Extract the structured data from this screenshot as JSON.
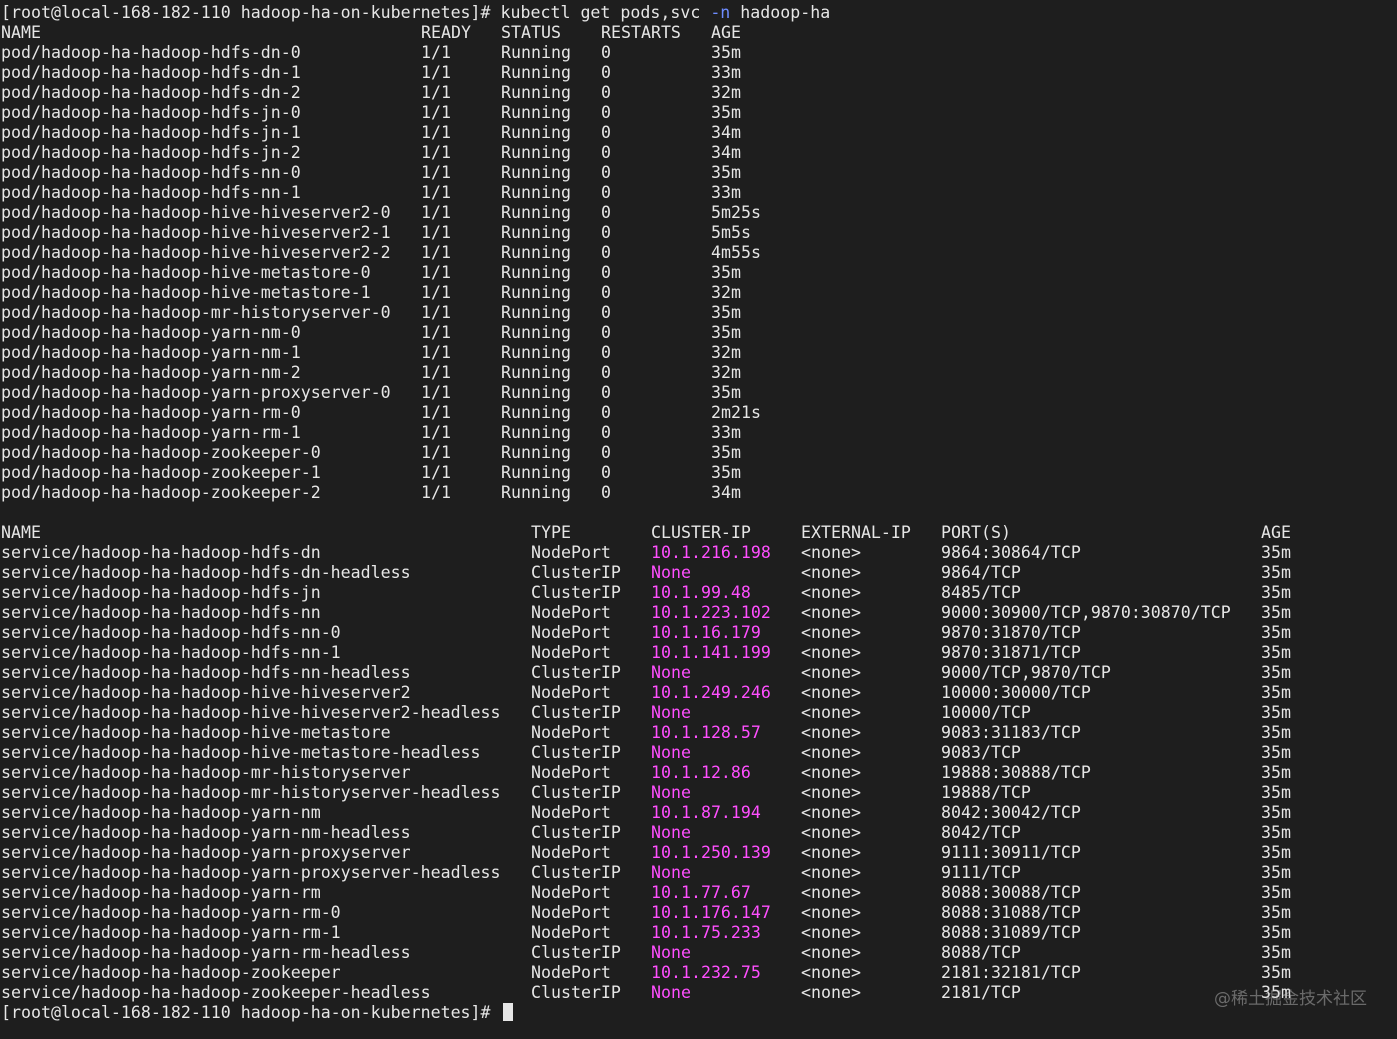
{
  "prompt": {
    "text": "[root@local-168-182-110 hadoop-ha-on-kubernetes]# ",
    "command": "kubectl get pods,svc ",
    "flag": "-n",
    "namespace": " hadoop-ha",
    "final_prompt": "[root@local-168-182-110 hadoop-ha-on-kubernetes]#"
  },
  "pods": {
    "headers": [
      "NAME",
      "READY",
      "STATUS",
      "RESTARTS",
      "AGE"
    ],
    "rows": [
      [
        "pod/hadoop-ha-hadoop-hdfs-dn-0",
        "1/1",
        "Running",
        "0",
        "35m"
      ],
      [
        "pod/hadoop-ha-hadoop-hdfs-dn-1",
        "1/1",
        "Running",
        "0",
        "33m"
      ],
      [
        "pod/hadoop-ha-hadoop-hdfs-dn-2",
        "1/1",
        "Running",
        "0",
        "32m"
      ],
      [
        "pod/hadoop-ha-hadoop-hdfs-jn-0",
        "1/1",
        "Running",
        "0",
        "35m"
      ],
      [
        "pod/hadoop-ha-hadoop-hdfs-jn-1",
        "1/1",
        "Running",
        "0",
        "34m"
      ],
      [
        "pod/hadoop-ha-hadoop-hdfs-jn-2",
        "1/1",
        "Running",
        "0",
        "34m"
      ],
      [
        "pod/hadoop-ha-hadoop-hdfs-nn-0",
        "1/1",
        "Running",
        "0",
        "35m"
      ],
      [
        "pod/hadoop-ha-hadoop-hdfs-nn-1",
        "1/1",
        "Running",
        "0",
        "33m"
      ],
      [
        "pod/hadoop-ha-hadoop-hive-hiveserver2-0",
        "1/1",
        "Running",
        "0",
        "5m25s"
      ],
      [
        "pod/hadoop-ha-hadoop-hive-hiveserver2-1",
        "1/1",
        "Running",
        "0",
        "5m5s"
      ],
      [
        "pod/hadoop-ha-hadoop-hive-hiveserver2-2",
        "1/1",
        "Running",
        "0",
        "4m55s"
      ],
      [
        "pod/hadoop-ha-hadoop-hive-metastore-0",
        "1/1",
        "Running",
        "0",
        "35m"
      ],
      [
        "pod/hadoop-ha-hadoop-hive-metastore-1",
        "1/1",
        "Running",
        "0",
        "32m"
      ],
      [
        "pod/hadoop-ha-hadoop-mr-historyserver-0",
        "1/1",
        "Running",
        "0",
        "35m"
      ],
      [
        "pod/hadoop-ha-hadoop-yarn-nm-0",
        "1/1",
        "Running",
        "0",
        "35m"
      ],
      [
        "pod/hadoop-ha-hadoop-yarn-nm-1",
        "1/1",
        "Running",
        "0",
        "32m"
      ],
      [
        "pod/hadoop-ha-hadoop-yarn-nm-2",
        "1/1",
        "Running",
        "0",
        "32m"
      ],
      [
        "pod/hadoop-ha-hadoop-yarn-proxyserver-0",
        "1/1",
        "Running",
        "0",
        "35m"
      ],
      [
        "pod/hadoop-ha-hadoop-yarn-rm-0",
        "1/1",
        "Running",
        "0",
        "2m21s"
      ],
      [
        "pod/hadoop-ha-hadoop-yarn-rm-1",
        "1/1",
        "Running",
        "0",
        "33m"
      ],
      [
        "pod/hadoop-ha-hadoop-zookeeper-0",
        "1/1",
        "Running",
        "0",
        "35m"
      ],
      [
        "pod/hadoop-ha-hadoop-zookeeper-1",
        "1/1",
        "Running",
        "0",
        "35m"
      ],
      [
        "pod/hadoop-ha-hadoop-zookeeper-2",
        "1/1",
        "Running",
        "0",
        "34m"
      ]
    ]
  },
  "services": {
    "headers": [
      "NAME",
      "TYPE",
      "CLUSTER-IP",
      "EXTERNAL-IP",
      "PORT(S)",
      "AGE"
    ],
    "rows": [
      [
        "service/hadoop-ha-hadoop-hdfs-dn",
        "NodePort",
        "10.1.216.198",
        "<none>",
        "9864:30864/TCP",
        "35m"
      ],
      [
        "service/hadoop-ha-hadoop-hdfs-dn-headless",
        "ClusterIP",
        "None",
        "<none>",
        "9864/TCP",
        "35m"
      ],
      [
        "service/hadoop-ha-hadoop-hdfs-jn",
        "ClusterIP",
        "10.1.99.48",
        "<none>",
        "8485/TCP",
        "35m"
      ],
      [
        "service/hadoop-ha-hadoop-hdfs-nn",
        "NodePort",
        "10.1.223.102",
        "<none>",
        "9000:30900/TCP,9870:30870/TCP",
        "35m"
      ],
      [
        "service/hadoop-ha-hadoop-hdfs-nn-0",
        "NodePort",
        "10.1.16.179",
        "<none>",
        "9870:31870/TCP",
        "35m"
      ],
      [
        "service/hadoop-ha-hadoop-hdfs-nn-1",
        "NodePort",
        "10.1.141.199",
        "<none>",
        "9870:31871/TCP",
        "35m"
      ],
      [
        "service/hadoop-ha-hadoop-hdfs-nn-headless",
        "ClusterIP",
        "None",
        "<none>",
        "9000/TCP,9870/TCP",
        "35m"
      ],
      [
        "service/hadoop-ha-hadoop-hive-hiveserver2",
        "NodePort",
        "10.1.249.246",
        "<none>",
        "10000:30000/TCP",
        "35m"
      ],
      [
        "service/hadoop-ha-hadoop-hive-hiveserver2-headless",
        "ClusterIP",
        "None",
        "<none>",
        "10000/TCP",
        "35m"
      ],
      [
        "service/hadoop-ha-hadoop-hive-metastore",
        "NodePort",
        "10.1.128.57",
        "<none>",
        "9083:31183/TCP",
        "35m"
      ],
      [
        "service/hadoop-ha-hadoop-hive-metastore-headless",
        "ClusterIP",
        "None",
        "<none>",
        "9083/TCP",
        "35m"
      ],
      [
        "service/hadoop-ha-hadoop-mr-historyserver",
        "NodePort",
        "10.1.12.86",
        "<none>",
        "19888:30888/TCP",
        "35m"
      ],
      [
        "service/hadoop-ha-hadoop-mr-historyserver-headless",
        "ClusterIP",
        "None",
        "<none>",
        "19888/TCP",
        "35m"
      ],
      [
        "service/hadoop-ha-hadoop-yarn-nm",
        "NodePort",
        "10.1.87.194",
        "<none>",
        "8042:30042/TCP",
        "35m"
      ],
      [
        "service/hadoop-ha-hadoop-yarn-nm-headless",
        "ClusterIP",
        "None",
        "<none>",
        "8042/TCP",
        "35m"
      ],
      [
        "service/hadoop-ha-hadoop-yarn-proxyserver",
        "NodePort",
        "10.1.250.139",
        "<none>",
        "9111:30911/TCP",
        "35m"
      ],
      [
        "service/hadoop-ha-hadoop-yarn-proxyserver-headless",
        "ClusterIP",
        "None",
        "<none>",
        "9111/TCP",
        "35m"
      ],
      [
        "service/hadoop-ha-hadoop-yarn-rm",
        "NodePort",
        "10.1.77.67",
        "<none>",
        "8088:30088/TCP",
        "35m"
      ],
      [
        "service/hadoop-ha-hadoop-yarn-rm-0",
        "NodePort",
        "10.1.176.147",
        "<none>",
        "8088:31088/TCP",
        "35m"
      ],
      [
        "service/hadoop-ha-hadoop-yarn-rm-1",
        "NodePort",
        "10.1.75.233",
        "<none>",
        "8088:31089/TCP",
        "35m"
      ],
      [
        "service/hadoop-ha-hadoop-yarn-rm-headless",
        "ClusterIP",
        "None",
        "<none>",
        "8088/TCP",
        "35m"
      ],
      [
        "service/hadoop-ha-hadoop-zookeeper",
        "NodePort",
        "10.1.232.75",
        "<none>",
        "2181:32181/TCP",
        "35m"
      ],
      [
        "service/hadoop-ha-hadoop-zookeeper-headless",
        "ClusterIP",
        "None",
        "<none>",
        "2181/TCP",
        "35m"
      ]
    ]
  },
  "watermark": "@稀土掘金技术社区",
  "colors": {
    "background": "#1e1e1e",
    "text": "#e6e6e6",
    "cluster_ip": "#ff4fff",
    "flag": "#6e8cff"
  }
}
